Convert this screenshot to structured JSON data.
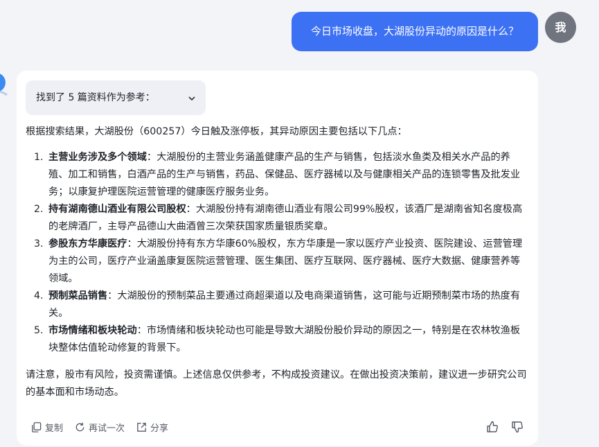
{
  "user": {
    "message": "今日市场收盘，大湖股份异动的原因是什么？",
    "avatar_text": "我"
  },
  "answer": {
    "references_label": "找到了 5 篇资料作为参考：",
    "intro": "根据搜索结果，大湖股份（600257）今日触及涨停板，其异动原因主要包括以下几点：",
    "points": [
      {
        "num": "1.",
        "title": "主营业务涉及多个领域",
        "text": "：大湖股份的主营业务涵盖健康产品的生产与销售，包括淡水鱼类及相关水产品的养殖、加工和销售，白酒产品的生产与销售，药品、保健品、医疗器械以及与健康相关产品的连锁零售及批发业务；以康复护理医院运营管理的健康医疗服务业务。"
      },
      {
        "num": "2.",
        "title": "持有湖南德山酒业有限公司股权",
        "text": "：大湖股份持有湖南德山酒业有限公司99%股权，该酒厂是湖南省知名度极高的老牌酒厂，主导产品德山大曲酒曾三次荣获国家质量银质奖章。"
      },
      {
        "num": "3.",
        "title": "参股东方华康医疗",
        "text": "：大湖股份持有东方华康60%股权，东方华康是一家以医疗产业投资、医院建设、运营管理为主的公司，医疗产业涵盖康复医院运营管理、医生集团、医疗互联网、医疗器械、医疗大数据、健康营养等领域。"
      },
      {
        "num": "4.",
        "title": "预制菜品销售",
        "text": "：大湖股份的预制菜品主要通过商超渠道以及电商渠道销售，这可能与近期预制菜市场的热度有关。"
      },
      {
        "num": "5.",
        "title": "市场情绪和板块轮动",
        "text": "：市场情绪和板块轮动也可能是导致大湖股份股价异动的原因之一，特别是在农林牧渔板块整体估值轮动修复的背景下。"
      }
    ],
    "note": "请注意，股市有风险，投资需谨慎。上述信息仅供参考，不构成投资建议。在做出投资决策前，建议进一步研究公司的基本面和市场动态。"
  },
  "actions": {
    "copy_label": "复制",
    "retry_label": "再试一次",
    "share_label": "分享"
  },
  "colors": {
    "user_bubble": "#3d71f4",
    "page_background": "#f3f4f7",
    "card_background": "#ffffff"
  }
}
